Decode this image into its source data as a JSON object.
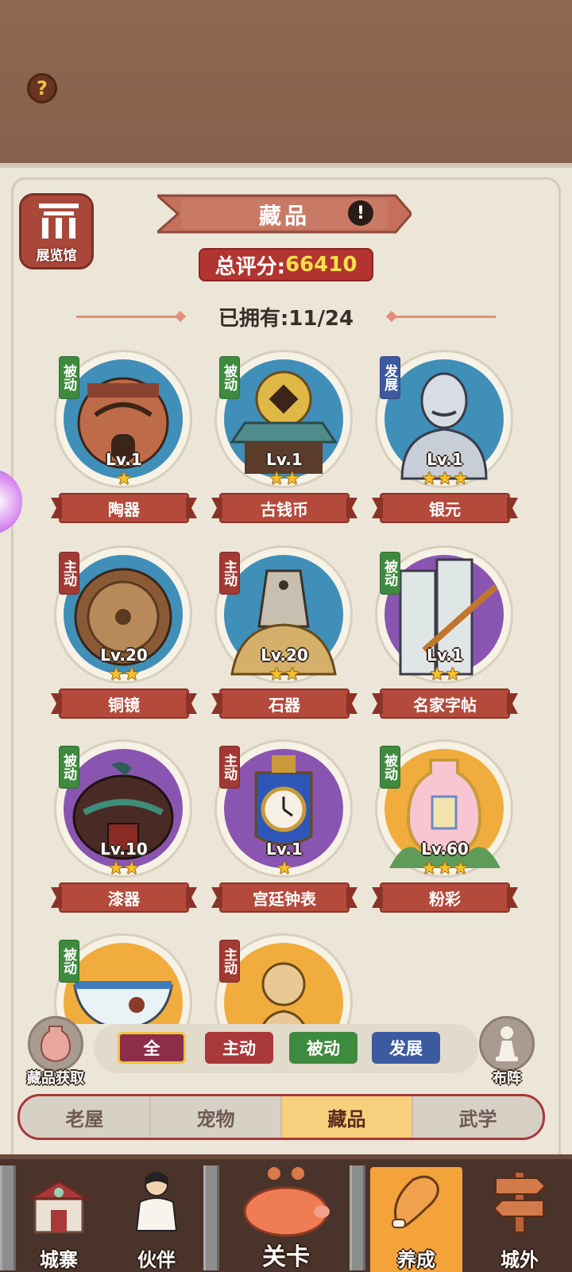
{
  "header": {
    "help_label": "?"
  },
  "hall_button": {
    "label": "展览馆"
  },
  "title": {
    "text": "藏品",
    "info_label": "!"
  },
  "score": {
    "label": "总评分:",
    "value": "66410"
  },
  "owned": {
    "label": "已拥有:11/24"
  },
  "collection": [
    {
      "id": "taoqi",
      "tag": "被动",
      "tag_type": "passive",
      "level": "Lv.1",
      "stars": 1,
      "name": "陶器",
      "disc": "blue",
      "icon": "pottery-jar-icon"
    },
    {
      "id": "guqianbi",
      "tag": "被动",
      "tag_type": "passive",
      "level": "Lv.1",
      "stars": 2,
      "name": "古钱币",
      "disc": "blue",
      "icon": "ancient-coin-icon"
    },
    {
      "id": "yinyuan",
      "tag": "发展",
      "tag_type": "develop",
      "level": "Lv.1",
      "stars": 3,
      "name": "银元",
      "disc": "blue",
      "icon": "silver-bust-icon"
    },
    {
      "id": "tongjing",
      "tag": "主动",
      "tag_type": "active",
      "level": "Lv.20",
      "stars": 2,
      "name": "铜镜",
      "disc": "blue",
      "icon": "bronze-mirror-icon"
    },
    {
      "id": "shiqi",
      "tag": "主动",
      "tag_type": "active",
      "level": "Lv.20",
      "stars": 2,
      "name": "石器",
      "disc": "blue",
      "icon": "stone-tool-icon"
    },
    {
      "id": "mingjiazitie",
      "tag": "被动",
      "tag_type": "passive",
      "level": "Lv.1",
      "stars": 2,
      "name": "名家字帖",
      "disc": "purple",
      "icon": "calligraphy-brush-icon"
    },
    {
      "id": "qiqi",
      "tag": "被动",
      "tag_type": "passive",
      "level": "Lv.10",
      "stars": 2,
      "name": "漆器",
      "disc": "purple",
      "icon": "lacquer-box-icon"
    },
    {
      "id": "gongtingzhongbiao",
      "tag": "主动",
      "tag_type": "active",
      "level": "Lv.1",
      "stars": 1,
      "name": "宫廷钟表",
      "disc": "purple",
      "icon": "palace-clock-icon"
    },
    {
      "id": "fencai",
      "tag": "被动",
      "tag_type": "passive",
      "level": "Lv.60",
      "stars": 3,
      "name": "粉彩",
      "disc": "orange",
      "icon": "famille-rose-vase-icon"
    },
    {
      "id": "bowl",
      "tag": "被动",
      "tag_type": "passive",
      "level": "",
      "stars": 0,
      "name": "",
      "disc": "orange",
      "icon": "rooster-bowl-icon"
    },
    {
      "id": "buddha",
      "tag": "主动",
      "tag_type": "active",
      "level": "",
      "stars": 0,
      "name": "",
      "disc": "orange",
      "icon": "buddha-statue-icon"
    }
  ],
  "filters": {
    "all": "全",
    "active": "主动",
    "passive": "被动",
    "develop": "发展"
  },
  "side_buttons": {
    "acquire_label": "藏品获取",
    "formation_label": "布阵"
  },
  "tabs": [
    "老屋",
    "宠物",
    "藏品",
    "武学"
  ],
  "active_tab": "藏品",
  "bottom_nav": {
    "fortress": "城寨",
    "partner": "伙伴",
    "stage": "关卡",
    "develop": "养成",
    "outside": "城外"
  },
  "colors": {
    "accent_red": "#b44a3c",
    "passive_green": "#3e8a3e",
    "develop_blue": "#3c5aa0",
    "highlight_orange": "#f4a23a"
  }
}
